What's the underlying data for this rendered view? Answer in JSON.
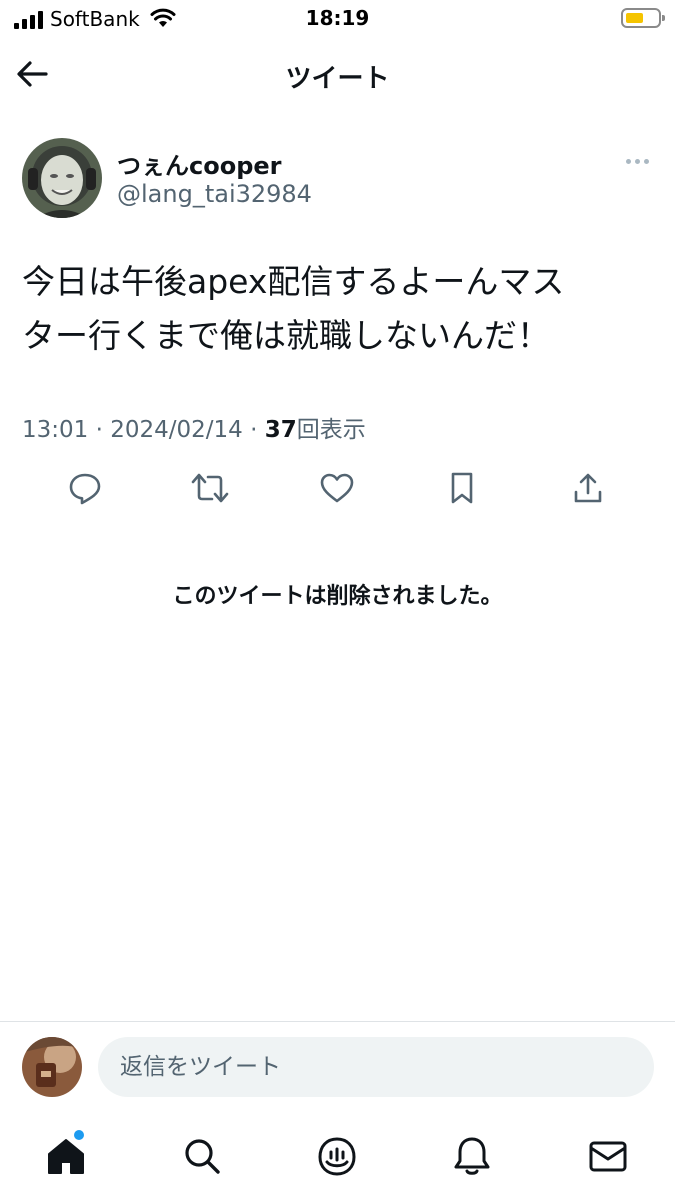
{
  "status_bar": {
    "carrier": "SoftBank",
    "time": "18:19"
  },
  "header": {
    "title": "ツイート"
  },
  "tweet": {
    "author": {
      "display_name": "つぇんcooper",
      "handle": "@lang_tai32984"
    },
    "text_line1": "今日は午後apex配信するよーんマス",
    "text_line2": "ター行くまで俺は就職しないんだ！",
    "time": "13:01",
    "separator": "·",
    "date": "2024/02/14",
    "views_count": "37",
    "views_label": "回表示"
  },
  "actions": [
    "reply-icon",
    "retweet-icon",
    "like-icon",
    "bookmark-icon",
    "share-icon"
  ],
  "deleted_notice": "このツイートは削除されました。",
  "reply_bar": {
    "placeholder": "返信をツイート"
  },
  "tabs": [
    "home-icon",
    "search-icon",
    "spaces-icon",
    "notifications-icon",
    "messages-icon"
  ],
  "colors": {
    "accent": "#1d9bf0",
    "secondary_text": "#536471",
    "icon": "#536471",
    "battery": "#f5c400"
  }
}
